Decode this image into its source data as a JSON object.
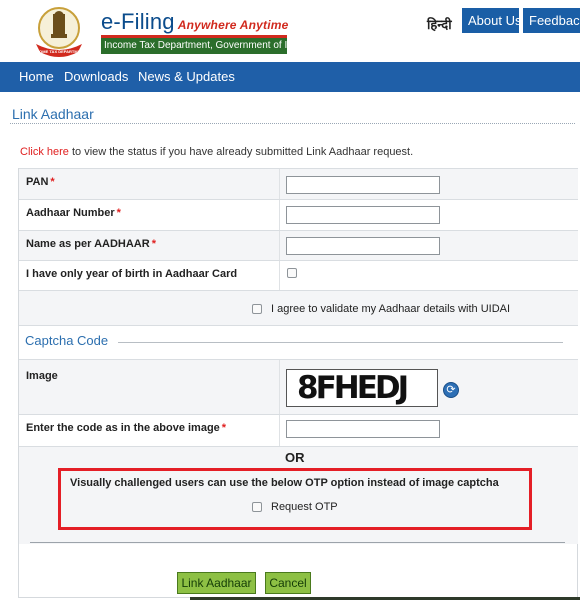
{
  "header": {
    "app_title": "e-Filing",
    "tagline": "Anywhere Anytime",
    "subtitle": "Income Tax Department, Government of India",
    "emblem_text": "INCOME TAX DEPARTMENT",
    "language_link": "हिन्दी",
    "about_button": "About Us",
    "feedback_button": "Feedback"
  },
  "nav": {
    "items": [
      "Home",
      "Downloads",
      "News & Updates"
    ]
  },
  "page": {
    "title": "Link Aadhaar",
    "status_link": "Click here",
    "status_text": " to view the status if you have already submitted Link Aadhaar request."
  },
  "form": {
    "pan_label": "PAN",
    "aadhaar_label": "Aadhaar Number",
    "name_label": "Name as per AADHAAR",
    "yob_label": "I have only year of birth in Aadhaar Card",
    "agree_label": "I agree to validate my Aadhaar details with UIDAI",
    "required_mark": "*",
    "pan_value": "",
    "aadhaar_value": "",
    "name_value": "",
    "yob_checked": false,
    "agree_checked": false
  },
  "captcha": {
    "section_title": "Captcha Code",
    "image_label": "Image",
    "captcha_text": "8FHEDJ",
    "code_label": "Enter the code as in the above image",
    "code_value": "",
    "or_text": "OR",
    "otp_notice": "Visually challenged users can use the below OTP option instead of image captcha",
    "otp_label": "Request OTP",
    "otp_checked": false
  },
  "actions": {
    "submit_label": "Link Aadhaar",
    "cancel_label": "Cancel"
  },
  "colors": {
    "nav_blue": "#1f5fa8",
    "accent_red": "#e41e26",
    "button_green": "#8dc044"
  },
  "icons": {
    "emblem": "state-emblem-icon",
    "refresh": "refresh-icon"
  }
}
